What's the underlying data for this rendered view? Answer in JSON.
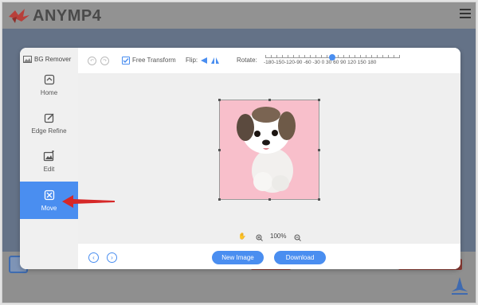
{
  "site": {
    "brand": "ANYMP4",
    "colors": {
      "overlay": "#445d84",
      "accent": "#4a8ef0",
      "image_bg": "#f8bfcb",
      "arrow": "#d62828"
    }
  },
  "modal": {
    "title": "BG Remover",
    "sidebar": [
      {
        "id": "home",
        "label": "Home",
        "icon": "home-icon",
        "active": false
      },
      {
        "id": "edge-refine",
        "label": "Edge Refine",
        "icon": "edge-refine-icon",
        "active": false
      },
      {
        "id": "edit",
        "label": "Edit",
        "icon": "edit-image-icon",
        "active": false
      },
      {
        "id": "move",
        "label": "Move",
        "icon": "move-icon",
        "active": true
      }
    ],
    "toolbar": {
      "undo_icon": "undo-icon",
      "redo_icon": "redo-icon",
      "free_transform_label": "Free Transform",
      "free_transform_checked": true,
      "flip_label": "Flip:",
      "rotate_label": "Rotate:",
      "rotate_ticks": "-180-150-120-90  -60 -30   0   30   60   90  120 150 180",
      "rotate_value": 0
    },
    "zoom": {
      "level": "100%"
    },
    "footer": {
      "new_image": "New Image",
      "download": "Download"
    }
  }
}
